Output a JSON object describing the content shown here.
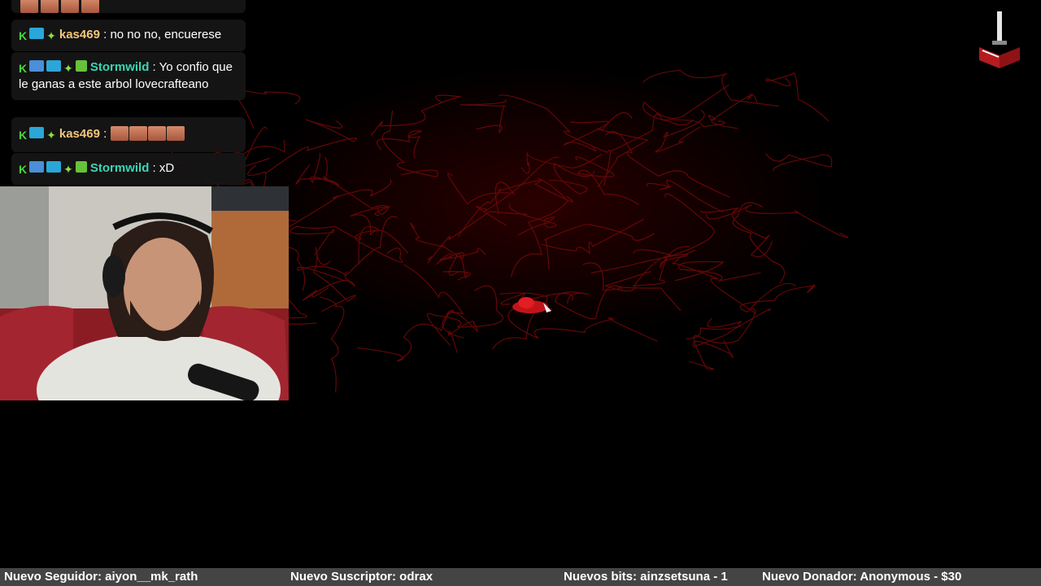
{
  "chat": {
    "messages": [
      {
        "user": "kas469",
        "separator": " : ",
        "text": "no no no, encuerese",
        "badges": [
          "k-badge",
          "ag-badge",
          "sparkle-badge"
        ]
      },
      {
        "user": "Stormwild",
        "separator": " : ",
        "text": "Yo confio que le ganas a este arbol lovecrafteano",
        "badges": [
          "k-badge",
          "pickaxe-badge",
          "ag-badge",
          "sparkle-badge",
          "gift-badge"
        ]
      },
      {
        "user": "kas469",
        "separator": " : ",
        "text": "",
        "emote_count": 4,
        "badges": [
          "k-badge",
          "ag-badge",
          "sparkle-badge"
        ]
      },
      {
        "user": "Stormwild",
        "separator": " : ",
        "text": "xD",
        "badges": [
          "k-badge",
          "pickaxe-badge",
          "ag-badge",
          "sparkle-badge",
          "gift-badge"
        ]
      }
    ],
    "colors": {
      "kas469": "#f2c77a",
      "Stormwild": "#3ad6b4"
    }
  },
  "ticker": {
    "follower": "Nuevo Seguidor: aiyon__mk_rath",
    "subscriber": "Nuevo Suscriptor: odrax",
    "bits": "Nuevos bits: ainzsetsuna - 1",
    "donor": "Nuevo Donador: Anonymous - $30"
  },
  "icons": {
    "logo": "book-sword-icon",
    "game_character": "red-creature-sprite"
  },
  "colors": {
    "tree_lines": "#7a0a0a",
    "ticker_bg": "#444444",
    "background": "#000000"
  }
}
